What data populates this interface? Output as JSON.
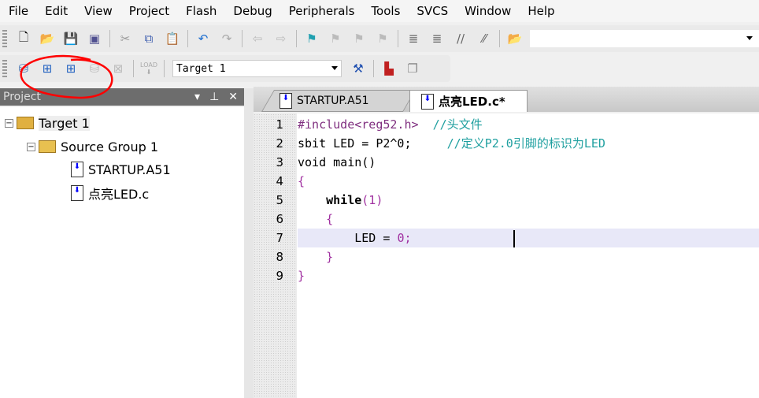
{
  "menu": [
    "File",
    "Edit",
    "View",
    "Project",
    "Flash",
    "Debug",
    "Peripherals",
    "Tools",
    "SVCS",
    "Window",
    "Help"
  ],
  "toolbar1": [
    "new-file-icon",
    "open-folder-icon",
    "save-icon",
    "save-all-icon",
    "cut-icon",
    "copy-icon",
    "paste-icon",
    "undo-icon",
    "redo-icon",
    "nav-back-icon",
    "nav-forward-icon",
    "bookmark-icon",
    "prev-bookmark-icon",
    "next-bookmark-icon",
    "clear-bookmarks-icon",
    "indent-icon",
    "unindent-icon",
    "comment-icon",
    "uncomment-icon",
    "find-in-files-icon"
  ],
  "toolbar2": {
    "load_label": "LOAD",
    "target": "Target 1"
  },
  "project": {
    "title": "Project",
    "tree": {
      "target": "Target 1",
      "group": "Source Group 1",
      "files": [
        "STARTUP.A51",
        "点亮LED.c"
      ]
    }
  },
  "tabs": [
    "STARTUP.A51",
    "点亮LED.c*"
  ],
  "editor": {
    "lines": [
      "1",
      "2",
      "3",
      "4",
      "5",
      "6",
      "7",
      "8",
      "9"
    ],
    "code": {
      "l1a": "#include<reg52.h>",
      "l1b": "  //头文件",
      "l2a": "sbit LED = P2^0;",
      "l2b": "     //定义P2.0引脚的标识为LED",
      "l3": "void main()",
      "l4": "{",
      "l5a": "    while",
      "l5b": "(1)",
      "l6": "    {",
      "l7a": "        LED = ",
      "l7b": "0;",
      "l8": "    }",
      "l9": "}"
    },
    "current_line": 7
  },
  "annotation_color": "#ff0000"
}
